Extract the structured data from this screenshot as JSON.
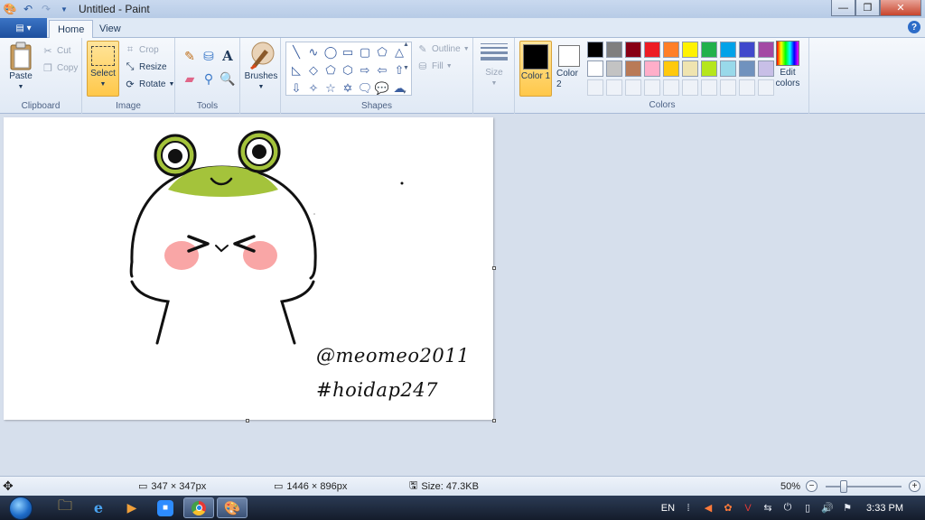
{
  "window": {
    "title": "Untitled - Paint",
    "controls": {
      "minimize": "—",
      "maximize": "❐",
      "close": "✕"
    }
  },
  "qat": {
    "save_icon": "save-icon",
    "undo_icon": "undo-icon",
    "redo_icon": "redo-icon"
  },
  "tabs": {
    "home": "Home",
    "view": "View"
  },
  "ribbon": {
    "clipboard": {
      "label": "Clipboard",
      "paste": "Paste",
      "cut": "Cut",
      "copy": "Copy"
    },
    "image": {
      "label": "Image",
      "select": "Select",
      "crop": "Crop",
      "resize": "Resize",
      "rotate": "Rotate"
    },
    "tools": {
      "label": "Tools"
    },
    "brushes": {
      "label": "Brushes"
    },
    "shapes": {
      "label": "Shapes",
      "outline": "Outline",
      "fill": "Fill"
    },
    "size": {
      "label": "Size"
    },
    "colors": {
      "label": "Colors",
      "color1": "Color 1",
      "color2": "Color 2",
      "edit": "Edit colors",
      "color1_value": "#000000",
      "color2_value": "#ffffff",
      "palette_row1": [
        "#000000",
        "#7f7f7f",
        "#880015",
        "#ed1c24",
        "#ff7f27",
        "#fff200",
        "#22b14c",
        "#00a2e8",
        "#3f48cc",
        "#a349a4"
      ],
      "palette_row2": [
        "#ffffff",
        "#c3c3c3",
        "#b97a57",
        "#ffaec9",
        "#ffc90e",
        "#efe4b0",
        "#b5e61d",
        "#99d9ea",
        "#7092be",
        "#c8bfe7"
      ]
    }
  },
  "canvas": {
    "watermark_line1": "@meomeo2011",
    "watermark_line2": "#hoidap247"
  },
  "statusbar": {
    "selection_size": "347 × 347px",
    "image_size": "1446 × 896px",
    "file_size": "Size: 47.3KB",
    "zoom": "50%",
    "zoom_out": "−",
    "zoom_in": "+"
  },
  "taskbar": {
    "language": "EN",
    "time": "3:33 PM"
  }
}
